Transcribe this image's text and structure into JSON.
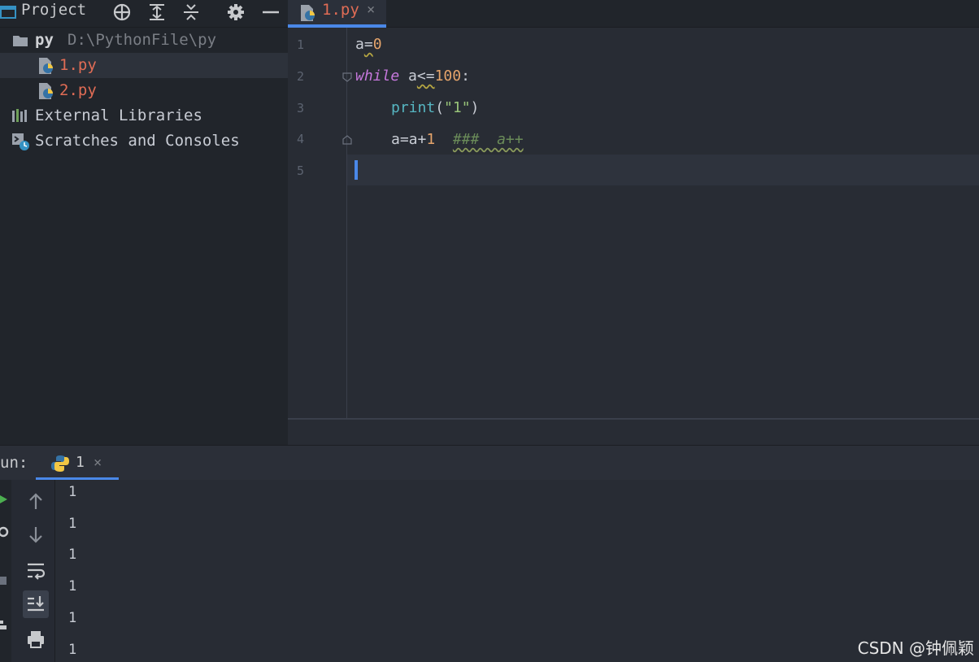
{
  "project_panel": {
    "title": "Project",
    "tree": {
      "root_name": "py",
      "root_path": "D:\\PythonFile\\py",
      "files": [
        "1.py",
        "2.py"
      ],
      "external_libraries": "External Libraries",
      "scratches": "Scratches and Consoles"
    }
  },
  "editor": {
    "active_tab": "1.py",
    "tab_close": "×",
    "line_numbers": [
      "1",
      "2",
      "3",
      "4",
      "5"
    ],
    "code": {
      "l1_var": "a",
      "l1_op": "=",
      "l1_num": "0",
      "l2_kw": "while",
      "l2_var": " a",
      "l2_op": "<=",
      "l2_num": "100",
      "l2_colon": ":",
      "l3_fn": "print",
      "l3_open": "(",
      "l3_str": "\"1\"",
      "l3_close": ")",
      "l4_expr": "a=a+",
      "l4_num": "1",
      "l4_comment": "###  a++"
    }
  },
  "run_panel": {
    "title": "un:",
    "tab_label": "1",
    "tab_close": "×",
    "output": [
      "1",
      "1",
      "1",
      "1",
      "1",
      "1"
    ]
  },
  "watermark": "CSDN @钟佩颖",
  "colors": {
    "accent": "#4a88e8",
    "keyword": "#c678dd",
    "number": "#e5a46b",
    "function": "#56b6c2",
    "string": "#98c379",
    "comment": "#6a8b59",
    "modified_file": "#e06c55"
  }
}
